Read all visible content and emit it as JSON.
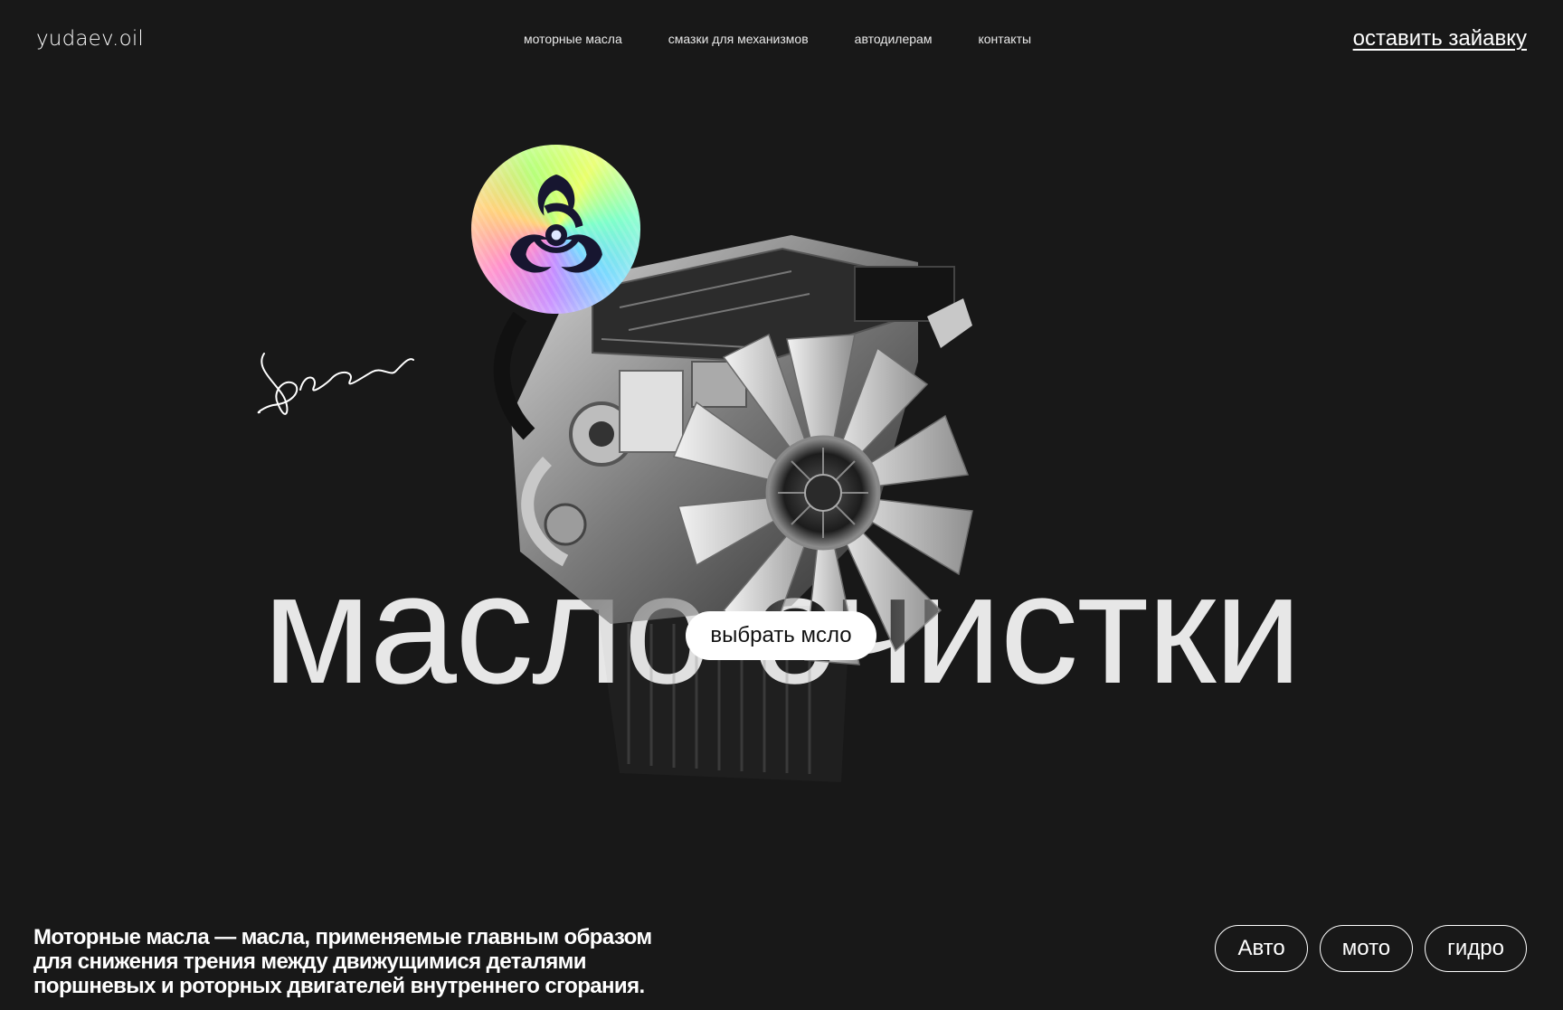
{
  "header": {
    "logo": "yudaev.oil",
    "nav": [
      {
        "label": "моторные масла"
      },
      {
        "label": "смазки для механизмов"
      },
      {
        "label": "автодилерам"
      },
      {
        "label": "контакты"
      }
    ],
    "cta": "оставить зайавку"
  },
  "hero": {
    "title": "масло очистки",
    "button": "выбрать мсло",
    "badge_icon": "biohazard-icon",
    "signature_icon": "signature-icon"
  },
  "description": "Моторные масла — масла, применяемые главным образом для снижения трения между движущимися деталями поршневых и роторных двигателей внутреннего сгорания.",
  "categories": [
    {
      "label": "Авто"
    },
    {
      "label": "мото"
    },
    {
      "label": "гидро"
    }
  ],
  "colors": {
    "background": "#181818",
    "text": "#ffffff"
  }
}
